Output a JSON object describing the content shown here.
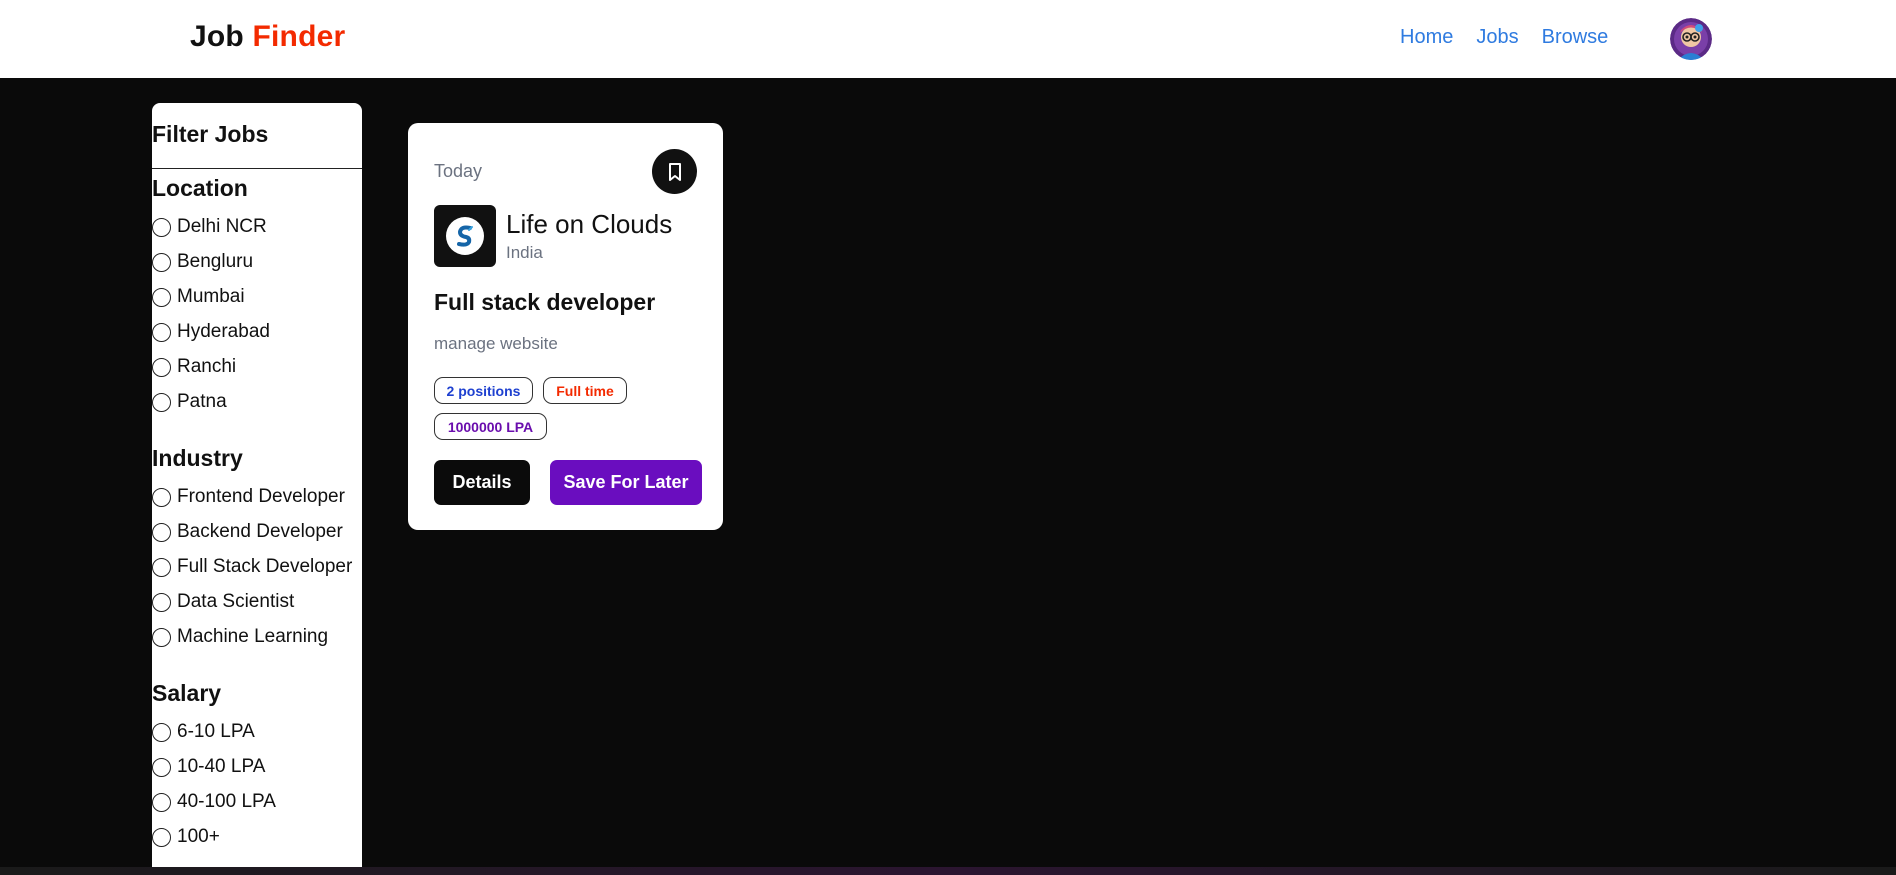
{
  "brand": {
    "part1": "Job",
    "part2": "Finder",
    "accent_color": "#f32a00"
  },
  "nav": {
    "links": [
      {
        "label": "Home"
      },
      {
        "label": "Jobs"
      },
      {
        "label": "Browse"
      }
    ],
    "link_color": "#2f7be0"
  },
  "filters": {
    "title": "Filter Jobs",
    "sections": [
      {
        "title": "Location",
        "options": [
          "Delhi NCR",
          "Bengluru",
          "Mumbai",
          "Hyderabad",
          "Ranchi",
          "Patna"
        ]
      },
      {
        "title": "Industry",
        "options": [
          "Frontend Developer",
          "Backend Developer",
          "Full Stack Developer",
          "Data Scientist",
          "Machine Learning"
        ]
      },
      {
        "title": "Salary",
        "options": [
          "6-10 LPA",
          "10-40 LPA",
          "40-100 LPA",
          "100+"
        ]
      }
    ]
  },
  "job_card": {
    "posted": "Today",
    "company": {
      "name": "Life on Clouds",
      "location": "India"
    },
    "title": "Full stack developer",
    "description": "manage website",
    "badges": {
      "positions": "2 positions",
      "job_type": "Full time",
      "salary": "1000000 LPA"
    },
    "actions": {
      "details": "Details",
      "save_later": "Save For Later"
    },
    "colors": {
      "positions": "#1e40d0",
      "job_type": "#f32a00",
      "salary": "#6a0dad",
      "save_button": "#6a0dbf"
    }
  },
  "icons": {
    "bookmark": "bookmark-icon",
    "avatar": "user-avatar",
    "company_logo": "company-logo-icon"
  }
}
